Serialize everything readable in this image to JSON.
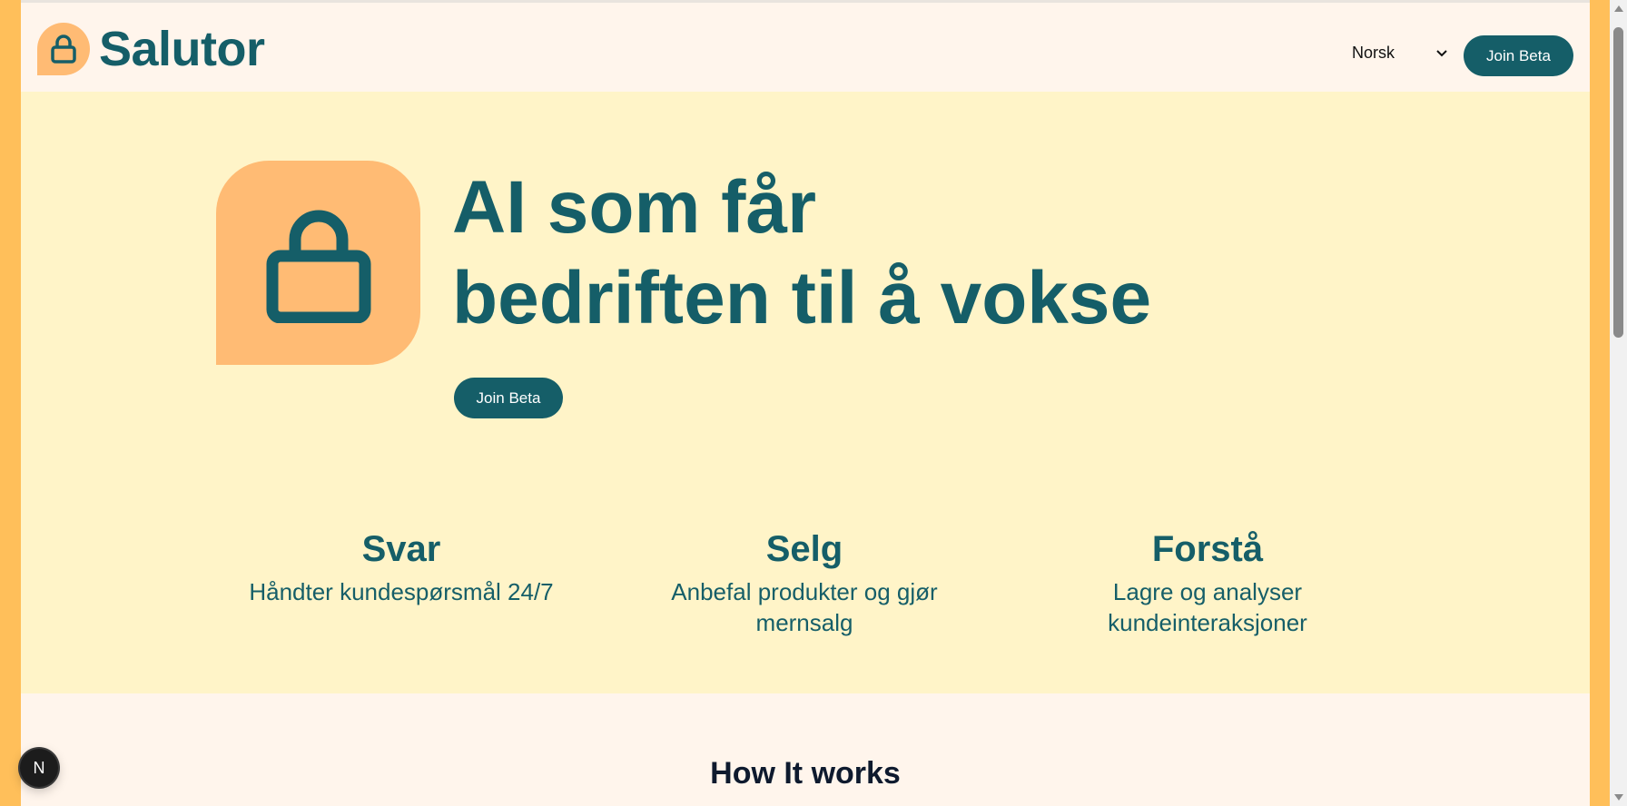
{
  "header": {
    "brand_name": "Salutor",
    "logo_icon": "padlock-icon",
    "language": {
      "selected": "Norsk",
      "icon": "chevron-down-icon"
    },
    "join_label": "Join Beta"
  },
  "hero": {
    "title_line1": "AI som får",
    "title_line2": "bedriften til å vokse",
    "join_label": "Join Beta",
    "logo_icon": "padlock-icon"
  },
  "features": [
    {
      "title": "Svar",
      "description": "Håndter kundespørsmål 24/7"
    },
    {
      "title": "Selg",
      "description": "Anbefal produkter og gjør mernsalg"
    },
    {
      "title": "Forstå",
      "description": "Lagre og analyser kundeinteraksjoner"
    }
  ],
  "how_it_works": {
    "title": "How It works"
  },
  "dev_badge": {
    "label": "N"
  },
  "colors": {
    "brand": "#155e68",
    "accent": "#ffbb74",
    "frame": "#ffbf5a",
    "hero_bg": "#fff4c8",
    "page_bg": "#fff5ec"
  }
}
